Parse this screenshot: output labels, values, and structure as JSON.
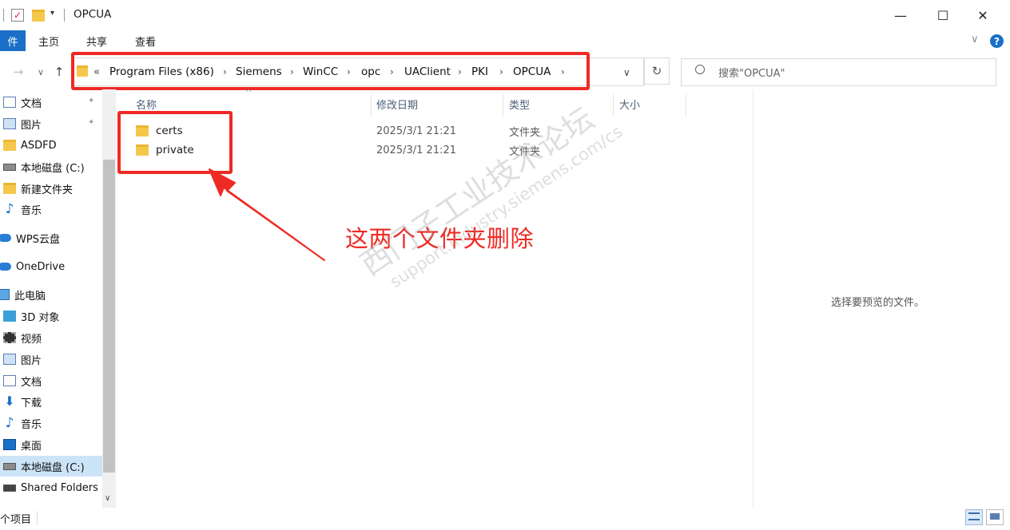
{
  "window": {
    "title": "OPCUA",
    "minimize": "—",
    "maximize": "☐",
    "close": "✕"
  },
  "ribbon": {
    "file": "件",
    "tabs": [
      "主页",
      "共享",
      "查看"
    ],
    "expand_chevron": "∨",
    "help": "?"
  },
  "nav": {
    "back": "→",
    "forward": "∨",
    "up": "↑"
  },
  "address": {
    "overflow": "«",
    "crumbs": [
      "Program Files (x86)",
      "Siemens",
      "WinCC",
      "opc",
      "UAClient",
      "PKI",
      "OPCUA"
    ],
    "separator": "›",
    "dropdown": "∨",
    "refresh": "↻"
  },
  "search": {
    "placeholder": "搜索\"OPCUA\""
  },
  "sidebar": {
    "items": [
      {
        "label": "文档",
        "icon": "document-icon",
        "pinned": true
      },
      {
        "label": "图片",
        "icon": "picture-icon",
        "pinned": true
      },
      {
        "label": "ASDFD",
        "icon": "folder-icon"
      },
      {
        "label": "本地磁盘 (C:)",
        "icon": "drive-icon"
      },
      {
        "label": "新建文件夹",
        "icon": "folder-icon"
      },
      {
        "label": "音乐",
        "icon": "music-icon"
      },
      {
        "label": "WPS云盘",
        "icon": "cloud-icon"
      },
      {
        "label": "OneDrive",
        "icon": "onedrive-icon"
      },
      {
        "label": "此电脑",
        "icon": "computer-icon"
      },
      {
        "label": "3D 对象",
        "icon": "3d-objects-icon"
      },
      {
        "label": "视频",
        "icon": "video-icon"
      },
      {
        "label": "图片",
        "icon": "picture-icon"
      },
      {
        "label": "文档",
        "icon": "document-icon"
      },
      {
        "label": "下载",
        "icon": "download-icon"
      },
      {
        "label": "音乐",
        "icon": "music-icon"
      },
      {
        "label": "桌面",
        "icon": "desktop-icon"
      },
      {
        "label": "本地磁盘 (C:)",
        "icon": "drive-icon",
        "selected": true
      },
      {
        "label": "Shared Folders",
        "icon": "network-drive-icon"
      }
    ],
    "pin_glyph": "📌"
  },
  "columns": {
    "name": "名称",
    "modified": "修改日期",
    "type": "类型",
    "size": "大小"
  },
  "files": [
    {
      "name": "certs",
      "modified": "2025/3/1 21:21",
      "type": "文件夹",
      "size": ""
    },
    {
      "name": "private",
      "modified": "2025/3/1 21:21",
      "type": "文件夹",
      "size": ""
    }
  ],
  "annotation": {
    "text": "这两个文件夹删除",
    "color": "#ee2a24"
  },
  "preview": {
    "text": "选择要预览的文件。"
  },
  "watermark": {
    "line1": "西门子工业技术论坛",
    "line2": "support.industry.siemens.com/cs"
  },
  "status": {
    "text": "个项目"
  },
  "colors": {
    "accent": "#1a70c8",
    "annotation": "#ee2a24",
    "folder": "#f5c84c"
  }
}
